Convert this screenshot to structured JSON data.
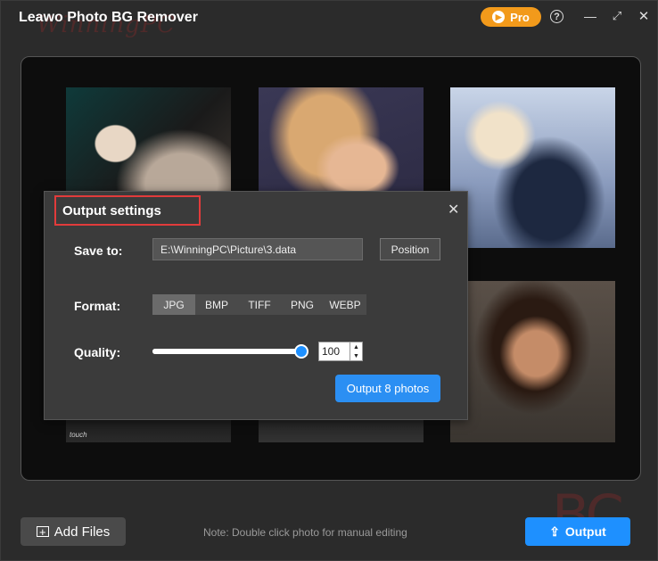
{
  "app": {
    "title": "Leawo Photo BG Remover",
    "pro_label": "Pro",
    "accent_color": "#1e90ff",
    "pro_color": "#f29a1b"
  },
  "titlebar": {
    "icons": [
      "help-icon",
      "minimize-icon",
      "maximize-icon",
      "close-icon"
    ]
  },
  "gallery": {
    "photos": [
      {
        "caption": ""
      },
      {
        "caption": ""
      },
      {
        "caption": ""
      },
      {
        "caption": "touch"
      },
      {
        "caption": ""
      },
      {
        "caption": ""
      }
    ]
  },
  "dialog": {
    "title": "Output settings",
    "save_to_label": "Save to:",
    "path_value": "E:\\WinningPC\\Picture\\3.data",
    "position_label": "Position",
    "format_label": "Format:",
    "formats": [
      "JPG",
      "BMP",
      "TIFF",
      "PNG",
      "WEBP"
    ],
    "selected_format": "JPG",
    "quality_label": "Quality:",
    "quality_value": "100",
    "output_button": "Output 8 photos"
  },
  "bottom": {
    "add_files_label": "Add Files",
    "note": "Note: Double click photo for manual editing",
    "output_label": "Output"
  },
  "watermark": {
    "text": "WinningPC",
    "logo": "BC"
  }
}
